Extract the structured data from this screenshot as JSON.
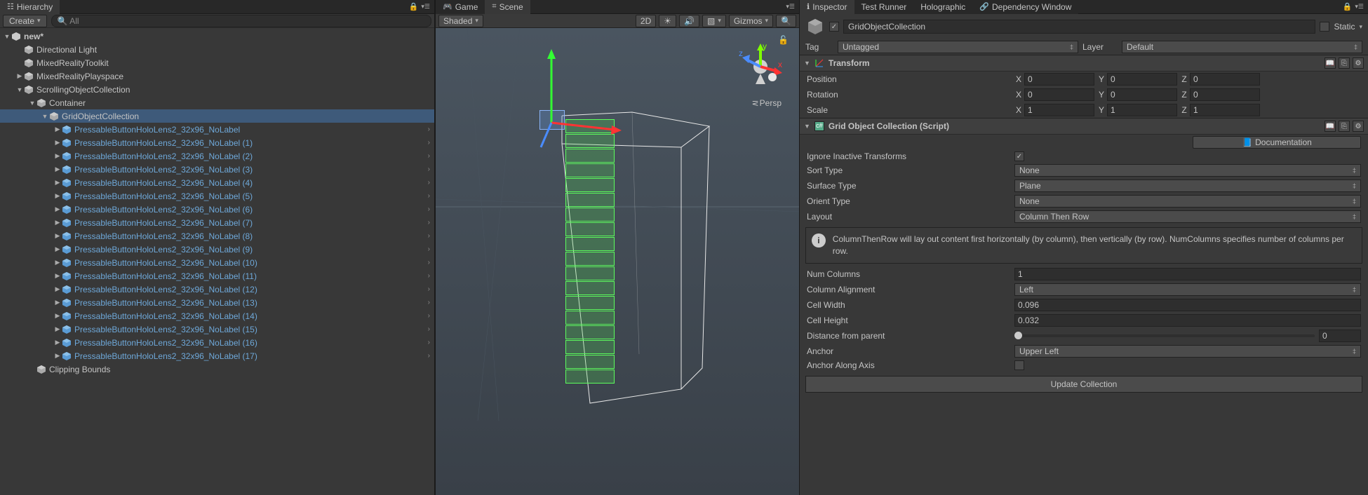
{
  "hierarchy": {
    "tab_label": "Hierarchy",
    "create_label": "Create",
    "search_placeholder": "All",
    "scene_name": "new*",
    "items": [
      {
        "label": "Directional Light",
        "depth": 1,
        "expand": "",
        "prefab": false,
        "chev": false
      },
      {
        "label": "MixedRealityToolkit",
        "depth": 1,
        "expand": "",
        "prefab": false,
        "chev": false
      },
      {
        "label": "MixedRealityPlayspace",
        "depth": 1,
        "expand": "▶",
        "prefab": false,
        "chev": false
      },
      {
        "label": "ScrollingObjectCollection",
        "depth": 1,
        "expand": "▼",
        "prefab": false,
        "chev": false
      },
      {
        "label": "Container",
        "depth": 2,
        "expand": "▼",
        "prefab": false,
        "chev": false
      },
      {
        "label": "GridObjectCollection",
        "depth": 3,
        "expand": "▼",
        "prefab": false,
        "chev": false,
        "selected": true
      },
      {
        "label": "PressableButtonHoloLens2_32x96_NoLabel",
        "depth": 4,
        "expand": "▶",
        "prefab": true,
        "chev": true
      },
      {
        "label": "PressableButtonHoloLens2_32x96_NoLabel (1)",
        "depth": 4,
        "expand": "▶",
        "prefab": true,
        "chev": true
      },
      {
        "label": "PressableButtonHoloLens2_32x96_NoLabel (2)",
        "depth": 4,
        "expand": "▶",
        "prefab": true,
        "chev": true
      },
      {
        "label": "PressableButtonHoloLens2_32x96_NoLabel (3)",
        "depth": 4,
        "expand": "▶",
        "prefab": true,
        "chev": true
      },
      {
        "label": "PressableButtonHoloLens2_32x96_NoLabel (4)",
        "depth": 4,
        "expand": "▶",
        "prefab": true,
        "chev": true
      },
      {
        "label": "PressableButtonHoloLens2_32x96_NoLabel (5)",
        "depth": 4,
        "expand": "▶",
        "prefab": true,
        "chev": true
      },
      {
        "label": "PressableButtonHoloLens2_32x96_NoLabel (6)",
        "depth": 4,
        "expand": "▶",
        "prefab": true,
        "chev": true
      },
      {
        "label": "PressableButtonHoloLens2_32x96_NoLabel (7)",
        "depth": 4,
        "expand": "▶",
        "prefab": true,
        "chev": true
      },
      {
        "label": "PressableButtonHoloLens2_32x96_NoLabel (8)",
        "depth": 4,
        "expand": "▶",
        "prefab": true,
        "chev": true
      },
      {
        "label": "PressableButtonHoloLens2_32x96_NoLabel (9)",
        "depth": 4,
        "expand": "▶",
        "prefab": true,
        "chev": true
      },
      {
        "label": "PressableButtonHoloLens2_32x96_NoLabel (10)",
        "depth": 4,
        "expand": "▶",
        "prefab": true,
        "chev": true
      },
      {
        "label": "PressableButtonHoloLens2_32x96_NoLabel (11)",
        "depth": 4,
        "expand": "▶",
        "prefab": true,
        "chev": true
      },
      {
        "label": "PressableButtonHoloLens2_32x96_NoLabel (12)",
        "depth": 4,
        "expand": "▶",
        "prefab": true,
        "chev": true
      },
      {
        "label": "PressableButtonHoloLens2_32x96_NoLabel (13)",
        "depth": 4,
        "expand": "▶",
        "prefab": true,
        "chev": true
      },
      {
        "label": "PressableButtonHoloLens2_32x96_NoLabel (14)",
        "depth": 4,
        "expand": "▶",
        "prefab": true,
        "chev": true
      },
      {
        "label": "PressableButtonHoloLens2_32x96_NoLabel (15)",
        "depth": 4,
        "expand": "▶",
        "prefab": true,
        "chev": true
      },
      {
        "label": "PressableButtonHoloLens2_32x96_NoLabel (16)",
        "depth": 4,
        "expand": "▶",
        "prefab": true,
        "chev": true
      },
      {
        "label": "PressableButtonHoloLens2_32x96_NoLabel (17)",
        "depth": 4,
        "expand": "▶",
        "prefab": true,
        "chev": true
      },
      {
        "label": "Clipping Bounds",
        "depth": 2,
        "expand": "",
        "prefab": false,
        "chev": false
      }
    ]
  },
  "scene": {
    "tab_game": "Game",
    "tab_scene": "Scene",
    "draw_mode": "Shaded",
    "mode_2d": "2D",
    "gizmos_label": "Gizmos",
    "persp_label": "Persp",
    "axis": {
      "x": "x",
      "y": "y",
      "z": "z"
    }
  },
  "inspector": {
    "tabs": [
      "Inspector",
      "Test Runner",
      "Holographic",
      "Dependency Window"
    ],
    "object_name": "GridObjectCollection",
    "static_label": "Static",
    "tag_label": "Tag",
    "tag_value": "Untagged",
    "layer_label": "Layer",
    "layer_value": "Default",
    "transform": {
      "title": "Transform",
      "position": {
        "label": "Position",
        "x": "0",
        "y": "0",
        "z": "0"
      },
      "rotation": {
        "label": "Rotation",
        "x": "0",
        "y": "0",
        "z": "0"
      },
      "scale": {
        "label": "Scale",
        "x": "1",
        "y": "1",
        "z": "1"
      }
    },
    "grid": {
      "title": "Grid Object Collection (Script)",
      "doc_btn": "Documentation",
      "ignore_inactive": {
        "label": "Ignore Inactive Transforms",
        "checked": true
      },
      "sort_type": {
        "label": "Sort Type",
        "value": "None"
      },
      "surface_type": {
        "label": "Surface Type",
        "value": "Plane"
      },
      "orient_type": {
        "label": "Orient Type",
        "value": "None"
      },
      "layout": {
        "label": "Layout",
        "value": "Column Then Row"
      },
      "info": "ColumnThenRow will lay out content first horizontally (by column), then vertically (by row). NumColumns specifies number of columns per row.",
      "num_columns": {
        "label": "Num Columns",
        "value": "1"
      },
      "column_alignment": {
        "label": "Column Alignment",
        "value": "Left"
      },
      "cell_width": {
        "label": "Cell Width",
        "value": "0.096"
      },
      "cell_height": {
        "label": "Cell Height",
        "value": "0.032"
      },
      "distance": {
        "label": "Distance from parent",
        "value": "0"
      },
      "anchor": {
        "label": "Anchor",
        "value": "Upper Left"
      },
      "anchor_along": {
        "label": "Anchor Along Axis",
        "checked": false
      },
      "update_btn": "Update Collection"
    }
  }
}
